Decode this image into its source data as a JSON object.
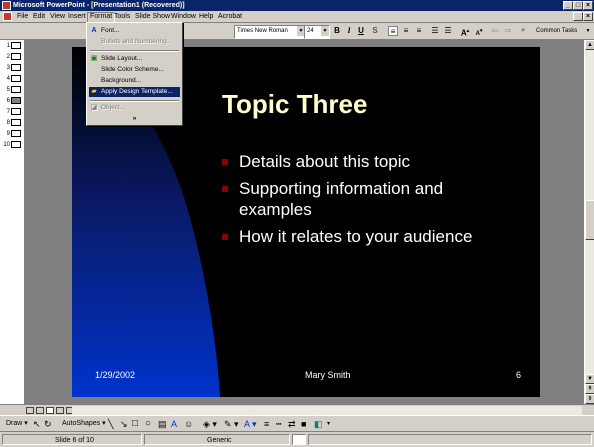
{
  "window": {
    "title": "Microsoft PowerPoint - [Presentation1 (Recovered)]",
    "min": "_",
    "max": "□",
    "close": "×"
  },
  "menubar": {
    "items": [
      "File",
      "Edit",
      "View",
      "Insert",
      "Format",
      "Tools",
      "Slide Show",
      "Window",
      "Help",
      "Acrobat"
    ]
  },
  "toolbar": {
    "font": "Times New Roman",
    "size": "24",
    "bold": "B",
    "italic": "I",
    "underline": "U",
    "shadow": "S",
    "common_tasks": "Common Tasks"
  },
  "format_menu": {
    "items": [
      {
        "label": "Font...",
        "disabled": false,
        "icon": "font-icon"
      },
      {
        "label": "Bullets and Numbering...",
        "disabled": true
      },
      {
        "label": "Slide Layout...",
        "disabled": false,
        "icon": "slide-layout-icon"
      },
      {
        "label": "Slide Color Scheme...",
        "disabled": false
      },
      {
        "label": "Background...",
        "disabled": false
      },
      {
        "label": "Apply Design Template...",
        "disabled": false,
        "highlighted": true,
        "icon": "design-template-icon"
      },
      {
        "label": "Object...",
        "disabled": true,
        "icon": "object-icon"
      }
    ],
    "expand": "»"
  },
  "outline": {
    "slides": [
      "1",
      "2",
      "3",
      "4",
      "5",
      "6",
      "7",
      "8",
      "9",
      "10"
    ],
    "current": "6"
  },
  "slide": {
    "title": "Topic Three",
    "bullets": [
      "Details about this topic",
      "Supporting information and examples",
      "How it relates to your audience"
    ],
    "date": "1/29/2002",
    "footer": "Mary Smith",
    "number": "6",
    "colors": {
      "background": "#000000",
      "accent": "#0033cc",
      "title": "#ffffcc",
      "bullet": "#8b0000"
    }
  },
  "drawbar": {
    "draw": "Draw",
    "autoshapes": "AutoShapes"
  },
  "status": {
    "slide": "Slide 6 of 10",
    "template": "Generic"
  }
}
